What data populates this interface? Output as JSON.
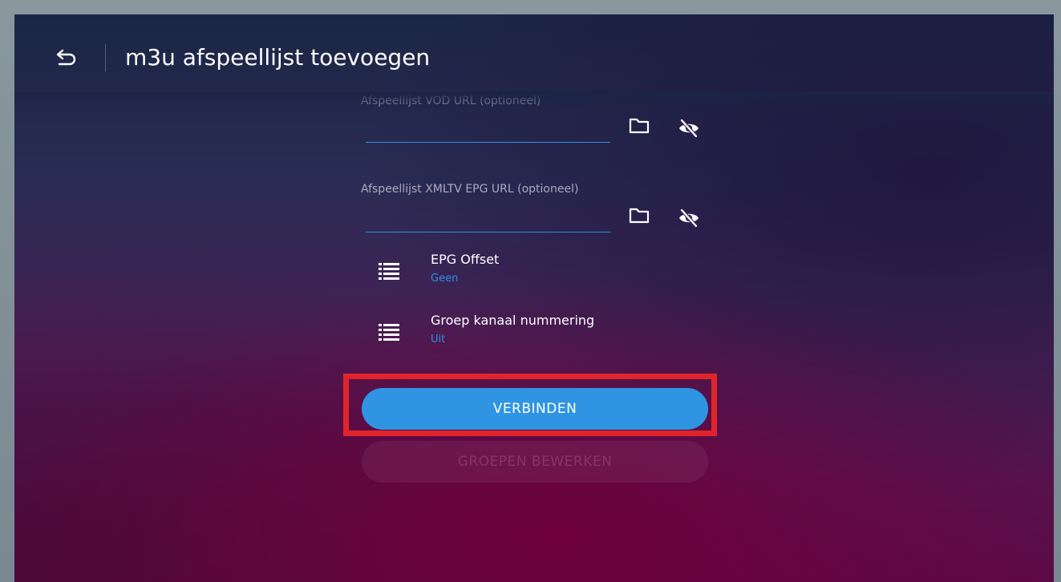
{
  "header": {
    "title": "m3u afspeellijst toevoegen",
    "back_icon": "back-arrow-icon"
  },
  "form": {
    "vod_url": {
      "label": "Afspeellijst VOD URL (optioneel)",
      "value": "",
      "folder_icon": "folder-icon",
      "visibility_icon": "eye-off-icon"
    },
    "epg_url": {
      "label": "Afspeellijst XMLTV EPG URL (optioneel)",
      "value": "",
      "folder_icon": "folder-icon",
      "visibility_icon": "eye-off-icon"
    }
  },
  "settings": [
    {
      "title": "EPG Offset",
      "value": "Geen",
      "icon": "list-icon"
    },
    {
      "title": "Groep kanaal nummering",
      "value": "Uit",
      "icon": "list-icon"
    }
  ],
  "buttons": {
    "connect_label": "VERBINDEN",
    "edit_groups_label": "GROEPEN BEWERKEN"
  },
  "colors": {
    "accent": "#2f95e2",
    "highlight": "#e0242b",
    "text": "#ffffff"
  }
}
